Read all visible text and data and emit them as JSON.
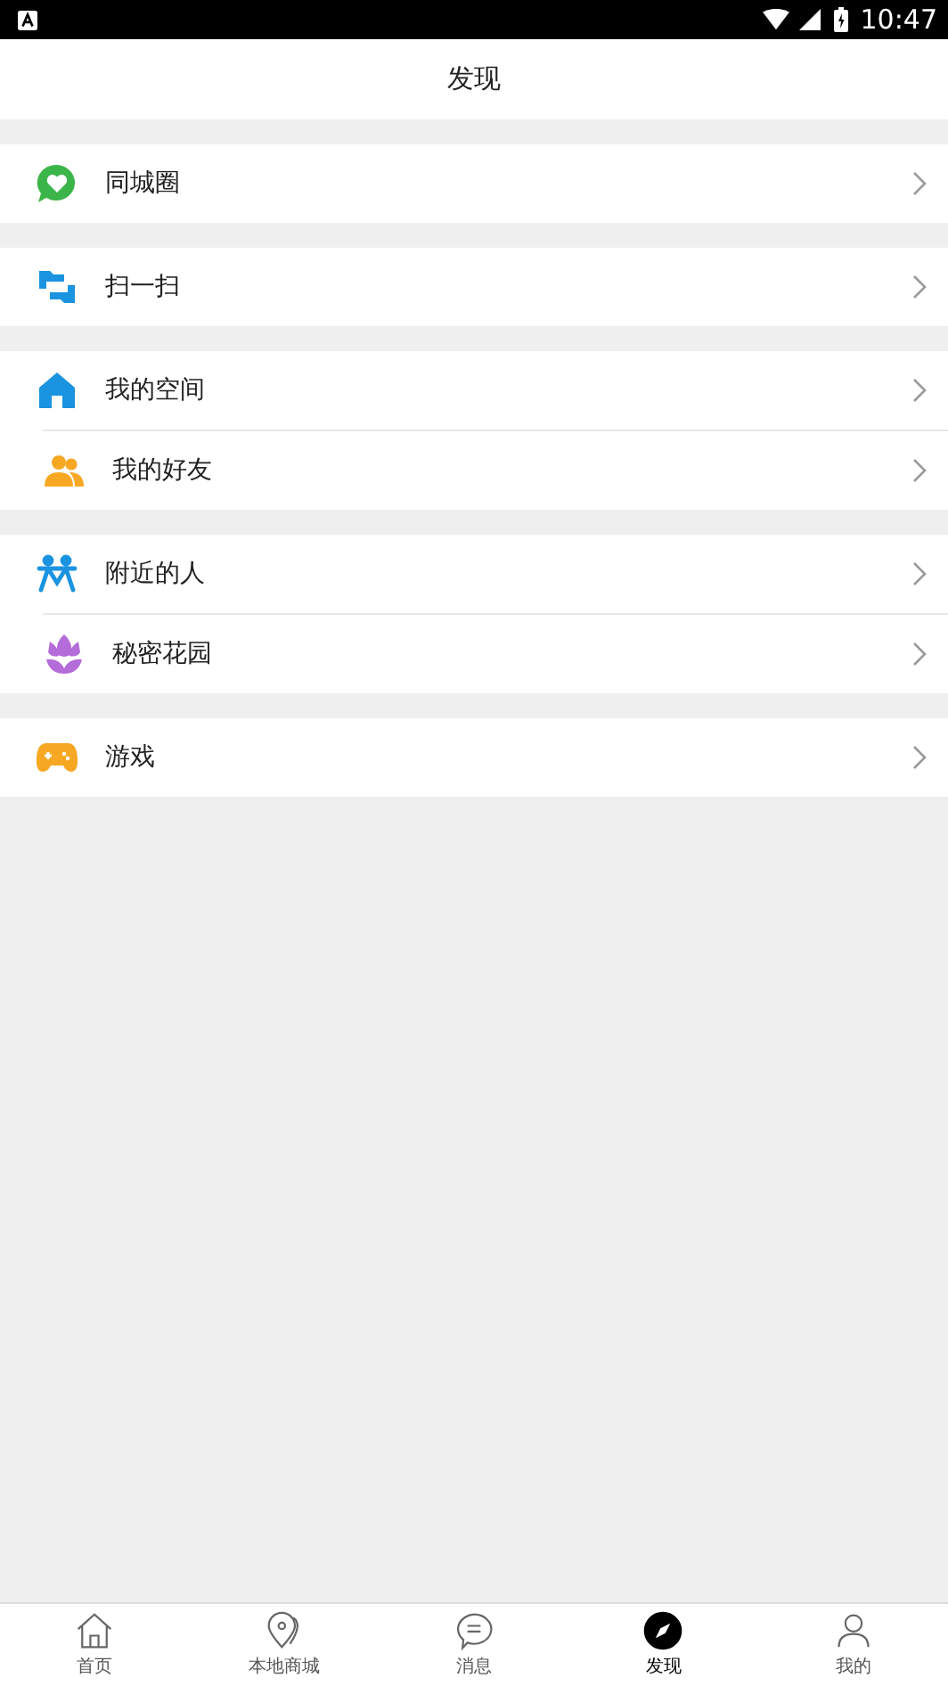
{
  "status_bar": {
    "time": "10:47"
  },
  "header": {
    "title": "发现"
  },
  "groups": [
    {
      "items": [
        {
          "label": "同城圈",
          "kind": "chat"
        }
      ]
    },
    {
      "items": [
        {
          "label": "扫一扫",
          "kind": "scan"
        }
      ]
    },
    {
      "items": [
        {
          "label": "我的空间",
          "kind": "home"
        },
        {
          "label": "我的好友",
          "kind": "friends"
        }
      ]
    },
    {
      "items": [
        {
          "label": "附近的人",
          "kind": "people"
        },
        {
          "label": "秘密花园",
          "kind": "flower"
        }
      ]
    },
    {
      "items": [
        {
          "label": "游戏",
          "kind": "game"
        }
      ]
    }
  ],
  "tab_bar": [
    {
      "label": "首页",
      "kind": "home",
      "selected": false
    },
    {
      "label": "本地商城",
      "kind": "pin",
      "selected": false
    },
    {
      "label": "消息",
      "kind": "message",
      "selected": false
    },
    {
      "label": "发现",
      "kind": "discover",
      "selected": true
    },
    {
      "label": "我的",
      "kind": "me",
      "selected": false
    }
  ]
}
